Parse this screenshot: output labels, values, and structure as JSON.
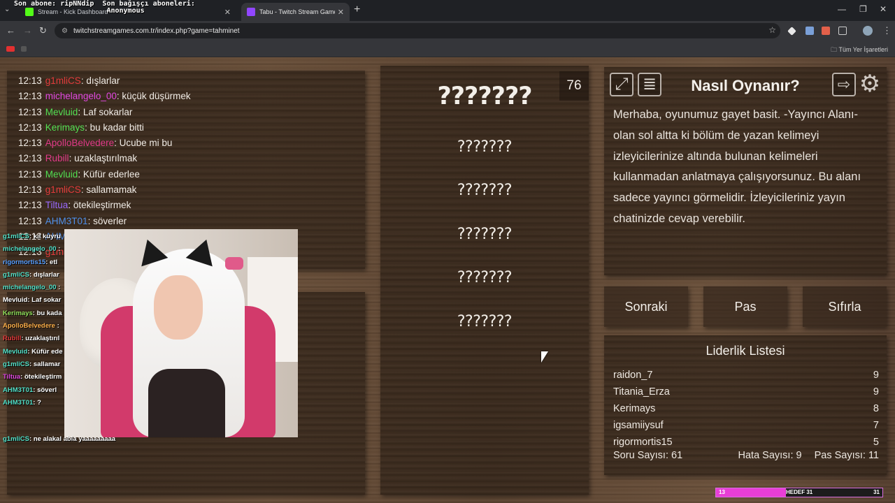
{
  "browser": {
    "overlay_text": "Son abone: ripNNdip  Son bağışçı aboneleri:\n                      Anonymous",
    "tabs": [
      {
        "label": "Stream - Kick Dashboard"
      },
      {
        "label": "Tabu - Twitch Stream Game"
      }
    ],
    "url": "twitchstreamgames.com.tr/index.php?game=tahminet",
    "bookmarks_all": "Tüm Yer İşaretleri"
  },
  "chat": {
    "lines": [
      {
        "time": "12:13",
        "user": "g1mliCS",
        "color": "#e23b3b",
        "msg": ": dışlarlar"
      },
      {
        "time": "12:13",
        "user": "michelangelo_00",
        "color": "#e048e0",
        "msg": ": küçük düşürmek"
      },
      {
        "time": "12:13",
        "user": "Mevluid",
        "color": "#53e053",
        "msg": ": Laf sokarlar"
      },
      {
        "time": "12:13",
        "user": "Kerimays",
        "color": "#53e053",
        "msg": ": bu kadar bitti"
      },
      {
        "time": "12:13",
        "user": "ApolloBelvedere",
        "color": "#e23b8a",
        "msg": ": Ucube mi bu"
      },
      {
        "time": "12:13",
        "user": "Rubill",
        "color": "#e23b8a",
        "msg": ": uzaklaştırılmak"
      },
      {
        "time": "12:13",
        "user": "Mevluid",
        "color": "#53e053",
        "msg": ": Küfür ederlee"
      },
      {
        "time": "12:13",
        "user": "g1mliCS",
        "color": "#e23b3b",
        "msg": ": sallamamak"
      },
      {
        "time": "12:13",
        "user": "Tiltua",
        "color": "#9b6bff",
        "msg": ": ötekileştirmek"
      },
      {
        "time": "12:13",
        "user": "AHM3T01",
        "color": "#4f8fe8",
        "msg": ": söverler"
      },
      {
        "time": "12:13",
        "user": "AHM3T01",
        "color": "#4f8fe8",
        "msg": ": ?"
      },
      {
        "time": "12:13",
        "user": "g1mliCS",
        "color": "#e23b3b",
        "msg": ": ne alakal abla yaaaaaaaaa"
      }
    ]
  },
  "mini_chat": {
    "lines": [
      {
        "user": "g1mliCS",
        "color": "#53e0c8",
        "msg": ": kıl kuyru"
      },
      {
        "user": "michelangelo_00",
        "color": "#53e0c8",
        "msg": " :"
      },
      {
        "user": "rigormortis15",
        "color": "#5aa0ff",
        "msg": ": etl"
      },
      {
        "user": "g1mliCS",
        "color": "#53e0c8",
        "msg": ": dışlarlar"
      },
      {
        "user": "michelangelo_00",
        "color": "#53e0c8",
        "msg": " :"
      },
      {
        "user": "Mevluid",
        "color": "#ffffff",
        "msg": ": Laf sokar"
      },
      {
        "user": "Kerimays",
        "color": "#8fe05a",
        "msg": ": bu kada"
      },
      {
        "user": "ApolloBelvedere",
        "color": "#ffb04a",
        "msg": " :"
      },
      {
        "user": "Rubill",
        "color": "#e23b3b",
        "msg": ": uzaklaştırıl"
      },
      {
        "user": "Mevluid",
        "color": "#53e0c8",
        "msg": ": Küfür ede"
      },
      {
        "user": "g1mliCS",
        "color": "#53e0c8",
        "msg": ": sallamar"
      },
      {
        "user": "Tiltua",
        "color": "#e048e0",
        "msg": ": ötekileştirm"
      },
      {
        "user": "AHM3T01",
        "color": "#53e0c8",
        "msg": ": söverl"
      },
      {
        "user": "AHM3T01",
        "color": "#53e0c8",
        "msg": ": ?"
      }
    ],
    "last": {
      "user": "g1mliCS",
      "color": "#53e0c8",
      "msg": ": ne alakal abla yaaaaaaaaa"
    }
  },
  "game": {
    "counter": "76",
    "word": "???????",
    "taboo": [
      "???????",
      "???????",
      "???????",
      "???????",
      "???????"
    ]
  },
  "how_to": {
    "title": "Nasıl Oynanır?",
    "text": "Merhaba, oyunumuz gayet basit. -Yayıncı Alanı- olan sol altta ki bölüm de yazan kelimeyi izleyicilerinize altında bulunan kelimeleri kullanmadan anlatmaya çalışıyorsunuz. Bu alanı sadece yayıncı görmelidir. İzleyicileriniz yayın chatinizde cevap verebilir."
  },
  "buttons": {
    "next": "Sonraki",
    "pass": "Pas",
    "reset": "Sıfırla"
  },
  "leaderboard": {
    "title": "Liderlik Listesi",
    "rows": [
      {
        "name": "raidon_7",
        "score": "9"
      },
      {
        "name": "Titania_Erza",
        "score": "9"
      },
      {
        "name": "Kerimays",
        "score": "8"
      },
      {
        "name": "igsamiiysuf",
        "score": "7"
      },
      {
        "name": "rigormortis15",
        "score": "5"
      }
    ],
    "questions": "Soru Sayısı: 61",
    "errors": "Hata Sayısı: 9",
    "passes": "Pas Sayısı: 11"
  },
  "goal": {
    "current": "13",
    "label": "HEDEF 31",
    "target": "31",
    "progress": 0.42
  }
}
